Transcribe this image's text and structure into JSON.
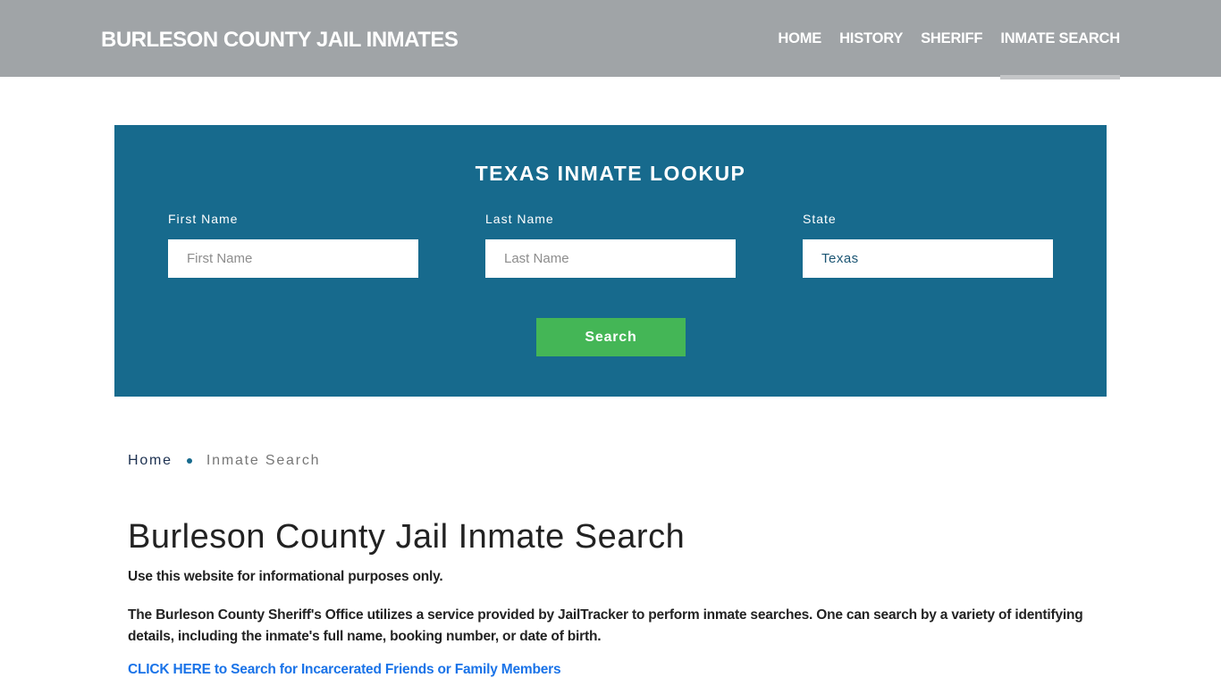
{
  "header": {
    "brand": "BURLESON COUNTY JAIL INMATES",
    "nav": [
      {
        "label": "HOME",
        "active": false
      },
      {
        "label": "HISTORY",
        "active": false
      },
      {
        "label": "SHERIFF",
        "active": false
      },
      {
        "label": "INMATE SEARCH",
        "active": true
      }
    ]
  },
  "lookup": {
    "title": "TEXAS INMATE LOOKUP",
    "fields": {
      "first_name": {
        "label": "First Name",
        "placeholder": "First Name",
        "value": ""
      },
      "last_name": {
        "label": "Last Name",
        "placeholder": "Last Name",
        "value": ""
      },
      "state": {
        "label": "State",
        "value": "Texas"
      }
    },
    "search_label": "Search"
  },
  "breadcrumb": {
    "home": "Home",
    "current": "Inmate Search"
  },
  "content": {
    "title": "Burleson County Jail Inmate Search",
    "note": "Use this website for informational purposes only.",
    "description": "The Burleson County Sheriff's Office utilizes a service provided by JailTracker to perform inmate searches. One can search by a variety of identifying details, including the inmate's full name, booking number, or date of birth.",
    "cta": "CLICK HERE to Search for Incarcerated Friends or Family Members"
  },
  "colors": {
    "header_bg": "#a0a4a7",
    "lookup_bg": "#176a8d",
    "search_button": "#44b656",
    "link": "#1a73e8"
  }
}
